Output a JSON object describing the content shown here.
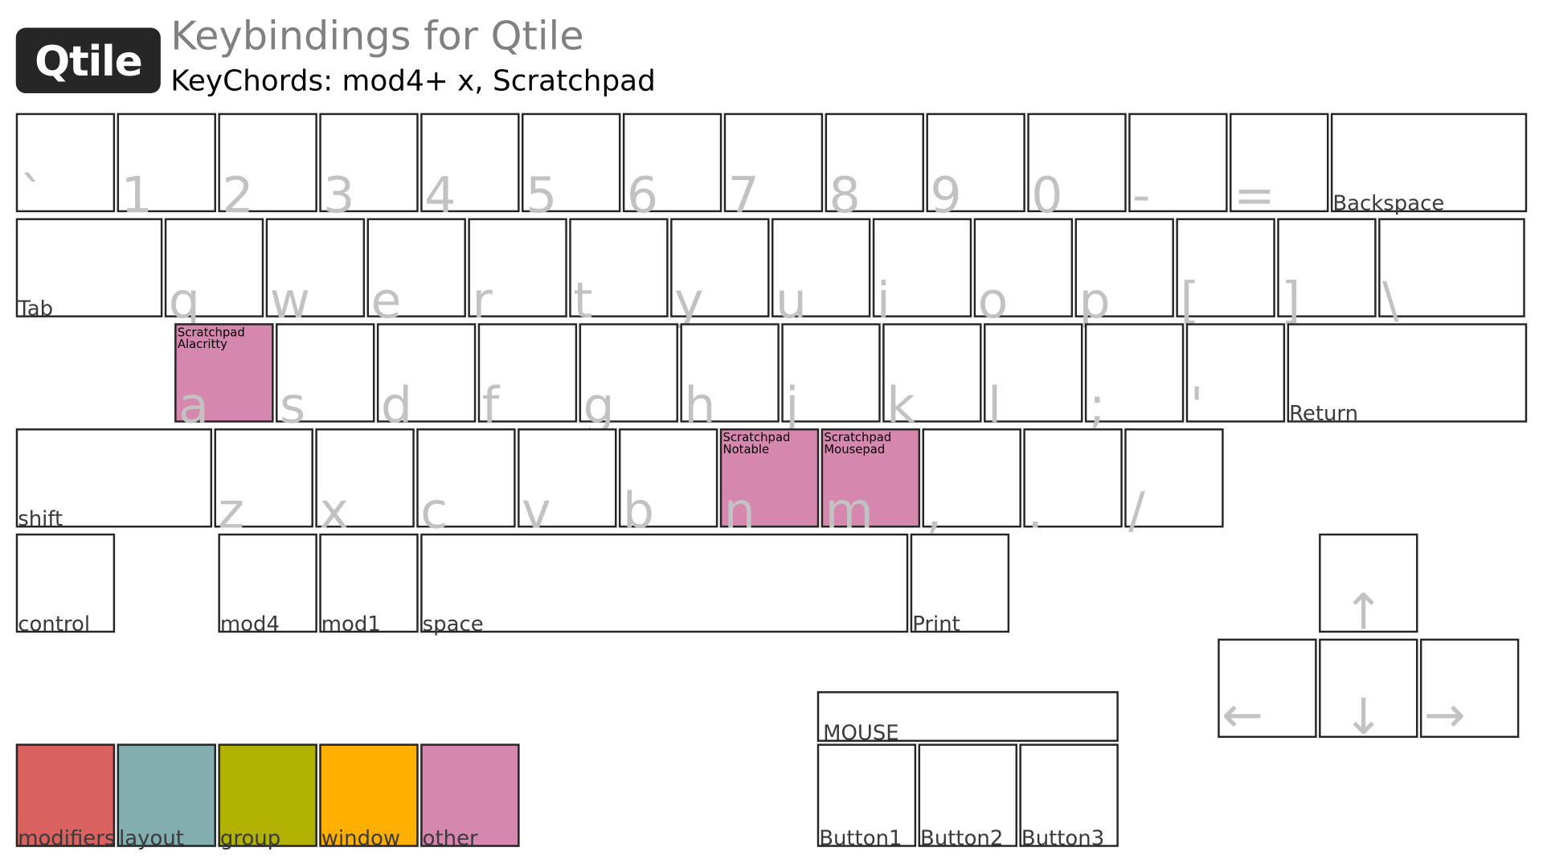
{
  "header": {
    "logo_text": "Qtile",
    "title": "Keybindings for Qtile",
    "subtitle": "KeyChords: mod4+ x, Scratchpad"
  },
  "colors": {
    "key_fill": "#ffffff",
    "key_border": "#262626",
    "highlight_other": "#d687ae",
    "modifiers": "#d9615f",
    "layout": "#83aeb0",
    "group": "#b0b100",
    "window": "#ffaf00",
    "other": "#d687ae"
  },
  "keyboard": {
    "row1": [
      {
        "label": "`",
        "type": "glyph"
      },
      {
        "label": "1",
        "type": "glyph"
      },
      {
        "label": "2",
        "type": "glyph"
      },
      {
        "label": "3",
        "type": "glyph"
      },
      {
        "label": "4",
        "type": "glyph"
      },
      {
        "label": "5",
        "type": "glyph"
      },
      {
        "label": "6",
        "type": "glyph"
      },
      {
        "label": "7",
        "type": "glyph"
      },
      {
        "label": "8",
        "type": "glyph"
      },
      {
        "label": "9",
        "type": "glyph"
      },
      {
        "label": "0",
        "type": "glyph"
      },
      {
        "label": "-",
        "type": "glyph"
      },
      {
        "label": "=",
        "type": "glyph"
      },
      {
        "label": "Backspace",
        "type": "word"
      }
    ],
    "row2": [
      {
        "label": "Tab",
        "type": "word"
      },
      {
        "label": "q",
        "type": "glyph"
      },
      {
        "label": "w",
        "type": "glyph"
      },
      {
        "label": "e",
        "type": "glyph"
      },
      {
        "label": "r",
        "type": "glyph"
      },
      {
        "label": "t",
        "type": "glyph"
      },
      {
        "label": "y",
        "type": "glyph"
      },
      {
        "label": "u",
        "type": "glyph"
      },
      {
        "label": "i",
        "type": "glyph"
      },
      {
        "label": "o",
        "type": "glyph"
      },
      {
        "label": "p",
        "type": "glyph"
      },
      {
        "label": "[",
        "type": "glyph"
      },
      {
        "label": "]",
        "type": "glyph"
      },
      {
        "label": "\\",
        "type": "glyph"
      }
    ],
    "row3": [
      {
        "label": "a",
        "type": "glyph",
        "binding": "Scratchpad\nAlacritty",
        "highlight": "other"
      },
      {
        "label": "s",
        "type": "glyph"
      },
      {
        "label": "d",
        "type": "glyph"
      },
      {
        "label": "f",
        "type": "glyph"
      },
      {
        "label": "g",
        "type": "glyph"
      },
      {
        "label": "h",
        "type": "glyph"
      },
      {
        "label": "j",
        "type": "glyph"
      },
      {
        "label": "k",
        "type": "glyph"
      },
      {
        "label": "l",
        "type": "glyph"
      },
      {
        "label": ";",
        "type": "glyph"
      },
      {
        "label": "'",
        "type": "glyph"
      },
      {
        "label": "Return",
        "type": "word"
      }
    ],
    "row4": [
      {
        "label": "shift",
        "type": "word"
      },
      {
        "label": "z",
        "type": "glyph"
      },
      {
        "label": "x",
        "type": "glyph"
      },
      {
        "label": "c",
        "type": "glyph"
      },
      {
        "label": "v",
        "type": "glyph"
      },
      {
        "label": "b",
        "type": "glyph"
      },
      {
        "label": "n",
        "type": "glyph",
        "binding": "Scratchpad\nNotable",
        "highlight": "other"
      },
      {
        "label": "m",
        "type": "glyph",
        "binding": "Scratchpad\nMousepad",
        "highlight": "other"
      },
      {
        "label": ",",
        "type": "glyph"
      },
      {
        "label": ".",
        "type": "glyph"
      },
      {
        "label": "/",
        "type": "glyph"
      }
    ],
    "row5": [
      {
        "label": "control",
        "type": "word"
      },
      {
        "label": "mod4",
        "type": "word"
      },
      {
        "label": "mod1",
        "type": "word"
      },
      {
        "label": "space",
        "type": "word"
      },
      {
        "label": "Print",
        "type": "word"
      }
    ],
    "arrows": [
      {
        "label": "↑",
        "type": "glyph"
      },
      {
        "label": "←",
        "type": "glyph"
      },
      {
        "label": "↓",
        "type": "glyph"
      },
      {
        "label": "→",
        "type": "glyph"
      }
    ]
  },
  "mouse": {
    "title": "MOUSE",
    "buttons": [
      "Button1",
      "Button2",
      "Button3"
    ]
  },
  "legend": [
    {
      "label": "modifiers",
      "color": "#d9615f"
    },
    {
      "label": "layout",
      "color": "#83aeb0"
    },
    {
      "label": "group",
      "color": "#b0b100"
    },
    {
      "label": "window",
      "color": "#ffaf00"
    },
    {
      "label": "other",
      "color": "#d687ae"
    }
  ]
}
